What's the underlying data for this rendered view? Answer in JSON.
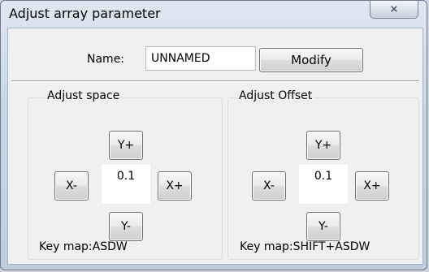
{
  "window": {
    "title": "Adjust array parameter",
    "close_icon": "close-icon",
    "close_glyph": "⨯"
  },
  "name_row": {
    "label": "Name:",
    "value": "UNNAMED",
    "modify_label": "Modify"
  },
  "adjust_space": {
    "title": "Adjust space",
    "y_plus": "Y+",
    "x_minus": "X-",
    "x_plus": "X+",
    "y_minus": "Y-",
    "value": "0.1",
    "keymap": "Key map:ASDW"
  },
  "adjust_offset": {
    "title": "Adjust Offset",
    "y_plus": "Y+",
    "x_minus": "X-",
    "x_plus": "X+",
    "y_minus": "Y-",
    "value": "0.1",
    "keymap": "Key map:SHIFT+ASDW"
  }
}
